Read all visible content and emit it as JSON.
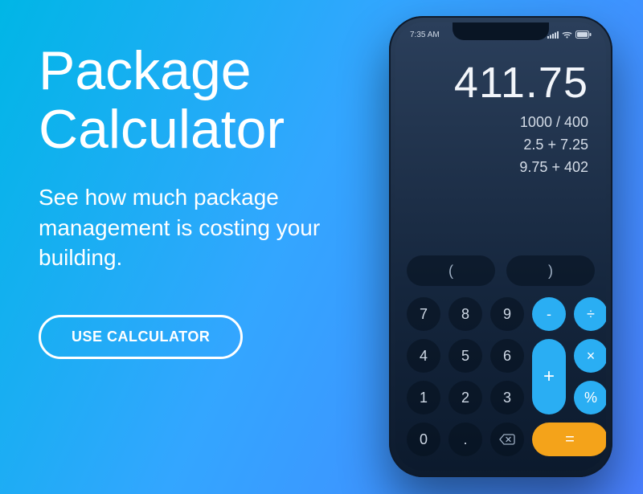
{
  "headline_line1": "Package",
  "headline_line2": "Calculator",
  "subhead": "See how much package management is costing your building.",
  "cta_label": "USE CALCULATOR",
  "phone": {
    "status_time": "7:35 AM",
    "result": "411.75",
    "history": [
      "1000 / 400",
      "2.5 + 7.25",
      "9.75 + 402"
    ],
    "keys": {
      "paren_open": "(",
      "paren_close": ")",
      "k7": "7",
      "k8": "8",
      "k9": "9",
      "minus": "-",
      "divide": "÷",
      "k4": "4",
      "k5": "5",
      "k6": "6",
      "plus": "+",
      "times": "×",
      "k1": "1",
      "k2": "2",
      "k3": "3",
      "percent": "%",
      "k0": "0",
      "dot": ".",
      "equals": "="
    }
  }
}
